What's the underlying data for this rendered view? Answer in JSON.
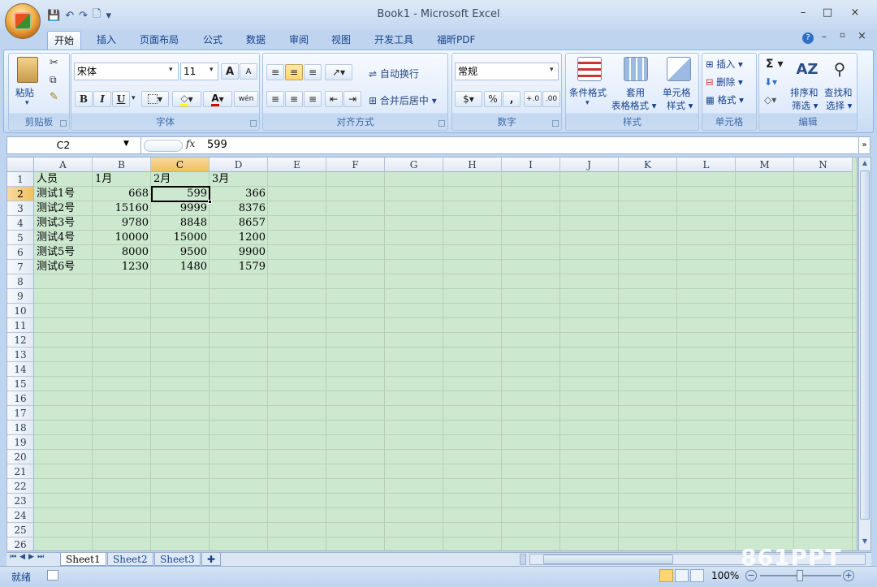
{
  "window": {
    "title": "Book1 - Microsoft Excel",
    "minimize": "–",
    "maximize": "□",
    "close": "×"
  },
  "qat": {
    "save": "💾",
    "undo": "↶",
    "redo": "↷",
    "preview": "🗋",
    "more": "▾"
  },
  "tabs": [
    "开始",
    "插入",
    "页面布局",
    "公式",
    "数据",
    "审阅",
    "视图",
    "开发工具",
    "福昕PDF"
  ],
  "ribbon": {
    "clipboard": {
      "label": "剪贴板",
      "paste": "粘贴"
    },
    "font": {
      "label": "字体",
      "name": "宋体",
      "size": "11",
      "bold": "B",
      "italic": "I",
      "underline": "U",
      "grow": "A",
      "shrink": "A",
      "wen": "wén"
    },
    "align": {
      "label": "对齐方式",
      "wrap": "自动换行",
      "merge": "合并后居中"
    },
    "number": {
      "label": "数字",
      "format": "常规",
      "percent": "%",
      "comma": ",",
      "inc": "+.0",
      "dec": ".00"
    },
    "styles": {
      "label": "样式",
      "cond": "条件格式",
      "table1": "套用",
      "table2": "表格格式",
      "cell1": "单元格",
      "cell2": "样式"
    },
    "cells": {
      "label": "单元格",
      "insert": "插入",
      "delete": "删除",
      "format": "格式"
    },
    "edit": {
      "label": "编辑",
      "sort1": "排序和",
      "sort2": "筛选",
      "find1": "查找和",
      "find2": "选择"
    }
  },
  "formula_bar": {
    "name_box": "C2",
    "fx": "fx",
    "value": "599"
  },
  "columns": [
    "A",
    "B",
    "C",
    "D",
    "E",
    "F",
    "G",
    "H",
    "I",
    "J",
    "K",
    "L",
    "M",
    "N"
  ],
  "rows": [
    "1",
    "2",
    "3",
    "4",
    "5",
    "6",
    "7",
    "8",
    "9",
    "10",
    "11",
    "12",
    "13",
    "14",
    "15",
    "16",
    "17",
    "18",
    "19",
    "20",
    "21",
    "22",
    "23",
    "24",
    "25",
    "26"
  ],
  "cells": {
    "r1": [
      "人员",
      "1月",
      "2月",
      "3月"
    ],
    "r2": [
      "测试1号",
      "668",
      "599",
      "366"
    ],
    "r3": [
      "测试2号",
      "15160",
      "9999",
      "8376"
    ],
    "r4": [
      "测试3号",
      "9780",
      "8848",
      "8657"
    ],
    "r5": [
      "测试4号",
      "10000",
      "15000",
      "1200"
    ],
    "r6": [
      "测试5号",
      "8000",
      "9500",
      "9900"
    ],
    "r7": [
      "测试6号",
      "1230",
      "1480",
      "1579"
    ]
  },
  "sheets": [
    "Sheet1",
    "Sheet2",
    "Sheet3"
  ],
  "status": {
    "ready": "就绪",
    "zoom": "100%"
  },
  "watermark": "861PPT",
  "colors": {
    "grid_bg": "#cce8cf",
    "ribbon": "#dfeafa",
    "selection_header": "#f1c15f"
  }
}
